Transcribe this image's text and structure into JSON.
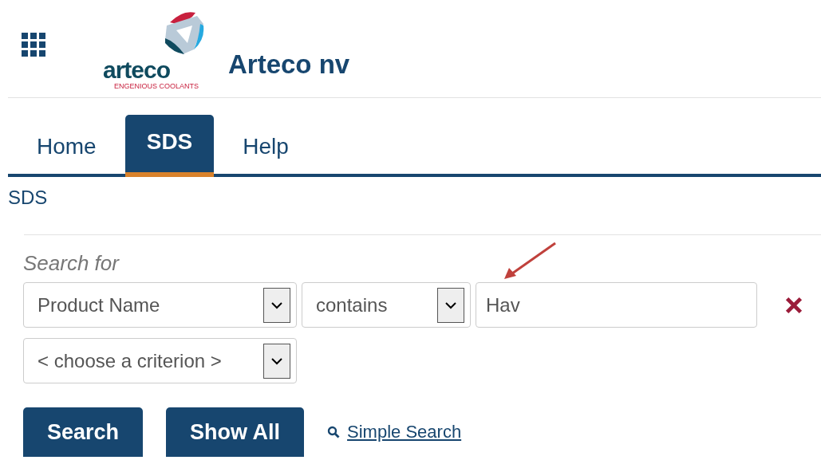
{
  "header": {
    "logo_text": "arteco",
    "logo_tagline": "ENGENIOUS COOLANTS",
    "title": "Arteco nv"
  },
  "tabs": [
    {
      "label": "Home",
      "selected": false
    },
    {
      "label": "SDS",
      "selected": true
    },
    {
      "label": "Help",
      "selected": false
    }
  ],
  "breadcrumb": "SDS",
  "search": {
    "heading": "Search for",
    "criteria": [
      {
        "field": "Product Name",
        "operator": "contains",
        "value": "Hav"
      },
      {
        "field": "< choose a criterion >"
      }
    ],
    "buttons": [
      "Search",
      "Show All"
    ],
    "simple_search_link": "Simple Search"
  }
}
